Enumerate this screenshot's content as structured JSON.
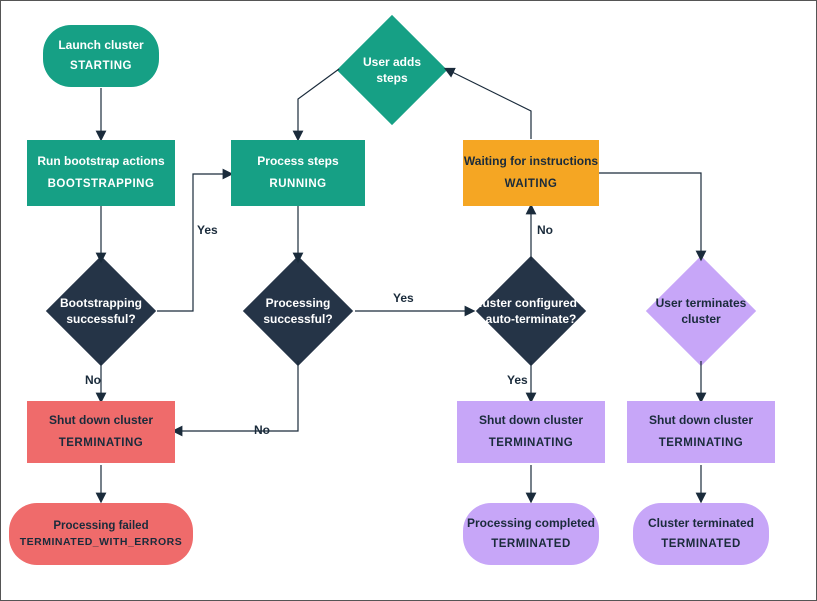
{
  "nodes": {
    "start": {
      "label": "Launch cluster",
      "status": "STARTING",
      "fill": "#16a085"
    },
    "bootstrap": {
      "label": "Run bootstrap actions",
      "status": "BOOTSTRAPPING",
      "fill": "#16a085"
    },
    "process": {
      "label": "Process steps",
      "status": "RUNNING",
      "fill": "#16a085"
    },
    "waiting": {
      "label": "Waiting for instructions",
      "status": "WAITING",
      "fill": "#f5a623",
      "text": "#1a2b3b"
    },
    "bootstrapOk": {
      "label": "Bootstrapping successful?",
      "fill": "#253447"
    },
    "processingOk": {
      "label": "Processing successful?",
      "fill": "#253447"
    },
    "autoTerminate": {
      "label": "Cluster configured to auto-terminate?",
      "fill": "#253447"
    },
    "userAdds": {
      "label": "User adds steps",
      "fill": "#16a085"
    },
    "userTerminates": {
      "label": "User terminates cluster",
      "fill": "#c7a6f8",
      "text": "#1a2b3b"
    },
    "shutdownFail": {
      "label": "Shut down cluster",
      "status": "TERMINATING",
      "fill": "#ef6b6b",
      "text": "#1a2b3b"
    },
    "shutdownAuto": {
      "label": "Shut down cluster",
      "status": "TERMINATING",
      "fill": "#c7a6f8",
      "text": "#1a2b3b"
    },
    "shutdownUser": {
      "label": "Shut down cluster",
      "status": "TERMINATING",
      "fill": "#c7a6f8",
      "text": "#1a2b3b"
    },
    "terminatedFail": {
      "label": "Processing failed",
      "status": "TERMINATED_WITH_ERRORS",
      "fill": "#ef6b6b",
      "text": "#1a2b3b"
    },
    "terminatedOk": {
      "label": "Processing completed",
      "status": "TERMINATED",
      "fill": "#c7a6f8",
      "text": "#1a2b3b"
    },
    "terminatedUser": {
      "label": "Cluster terminated",
      "status": "TERMINATED",
      "fill": "#c7a6f8",
      "text": "#1a2b3b"
    }
  },
  "edgeLabels": {
    "yes": "Yes",
    "no": "No"
  },
  "edges": [
    {
      "from": "start",
      "to": "bootstrap"
    },
    {
      "from": "bootstrap",
      "to": "bootstrapOk"
    },
    {
      "from": "bootstrapOk",
      "to": "process",
      "label": "Yes"
    },
    {
      "from": "bootstrapOk",
      "to": "shutdownFail",
      "label": "No"
    },
    {
      "from": "process",
      "to": "processingOk"
    },
    {
      "from": "processingOk",
      "to": "autoTerminate",
      "label": "Yes"
    },
    {
      "from": "processingOk",
      "to": "shutdownFail",
      "label": "No"
    },
    {
      "from": "autoTerminate",
      "to": "shutdownAuto",
      "label": "Yes"
    },
    {
      "from": "autoTerminate",
      "to": "waiting",
      "label": "No"
    },
    {
      "from": "waiting",
      "to": "userAdds"
    },
    {
      "from": "userAdds",
      "to": "process"
    },
    {
      "from": "waiting",
      "to": "userTerminates"
    },
    {
      "from": "userTerminates",
      "to": "shutdownUser"
    },
    {
      "from": "shutdownFail",
      "to": "terminatedFail"
    },
    {
      "from": "shutdownAuto",
      "to": "terminatedOk"
    },
    {
      "from": "shutdownUser",
      "to": "terminatedUser"
    }
  ]
}
